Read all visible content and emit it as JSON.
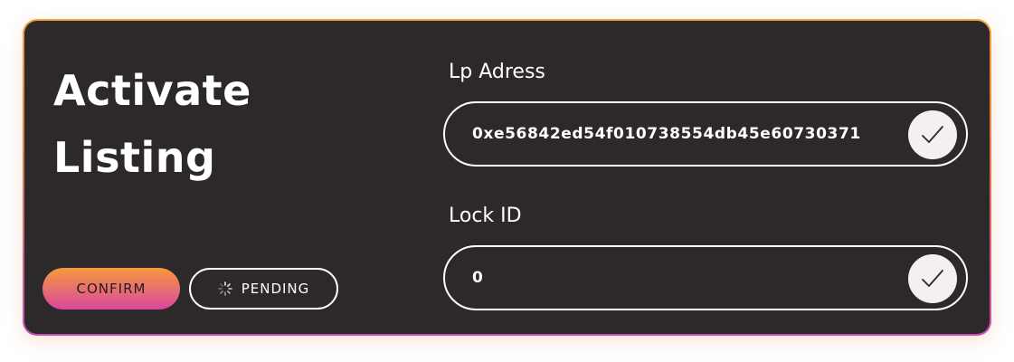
{
  "card": {
    "title_line1": "Activate",
    "title_line2": "Listing"
  },
  "buttons": {
    "confirm_label": "CONFIRM",
    "pending_label": "PENDING",
    "pending_icon": "spinner-icon"
  },
  "fields": {
    "lp_address": {
      "label": "Lp Adress",
      "value": "0xe56842ed54f010738554db45e60730371",
      "action_icon": "check-icon"
    },
    "lock_id": {
      "label": "Lock ID",
      "value": "0",
      "action_icon": "check-icon"
    }
  },
  "colors": {
    "card_background": "#2d2829",
    "gradient_start": "#f59a3c",
    "gradient_end": "#d9479f",
    "text": "#ffffff",
    "check_button_bg": "#f3f0ef"
  }
}
